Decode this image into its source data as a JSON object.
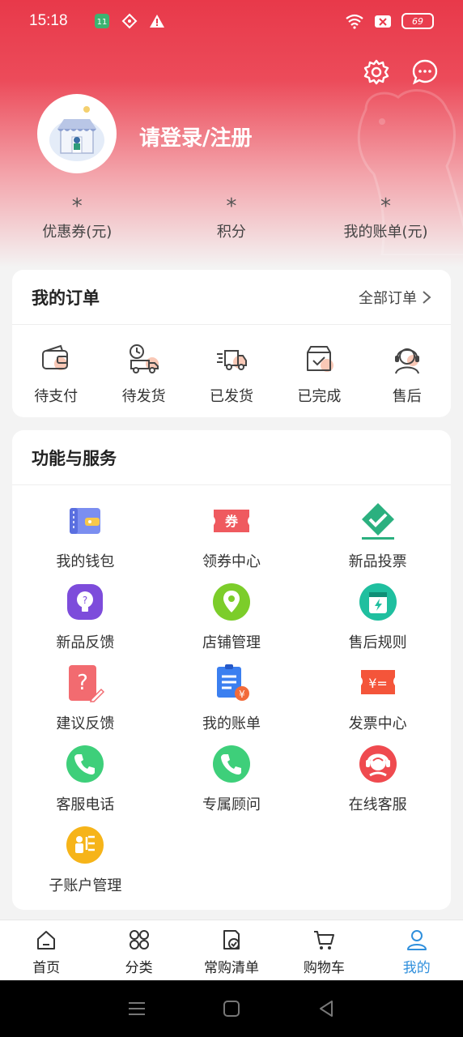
{
  "status_bar": {
    "time": "15:18",
    "battery": "69"
  },
  "header": {
    "login_text": "请登录/注册",
    "stats": [
      {
        "value": "*",
        "label": "优惠券(元)"
      },
      {
        "value": "*",
        "label": "积分"
      },
      {
        "value": "*",
        "label": "我的账单(元)"
      }
    ]
  },
  "orders": {
    "title": "我的订单",
    "all_link": "全部订单",
    "items": [
      {
        "label": "待支付",
        "icon": "wallet-icon"
      },
      {
        "label": "待发货",
        "icon": "truck-clock-icon"
      },
      {
        "label": "已发货",
        "icon": "delivery-truck-icon"
      },
      {
        "label": "已完成",
        "icon": "box-check-icon"
      },
      {
        "label": "售后",
        "icon": "headset-icon"
      }
    ]
  },
  "services": {
    "title": "功能与服务",
    "items": [
      {
        "label": "我的钱包",
        "icon": "wallet-icon"
      },
      {
        "label": "领券中心",
        "icon": "coupon-icon",
        "badge": "券"
      },
      {
        "label": "新品投票",
        "icon": "vote-icon"
      },
      {
        "label": "新品反馈",
        "icon": "lightbulb-icon"
      },
      {
        "label": "店铺管理",
        "icon": "location-pin-icon"
      },
      {
        "label": "售后规则",
        "icon": "rules-icon"
      },
      {
        "label": "建议反馈",
        "icon": "question-edit-icon"
      },
      {
        "label": "我的账单",
        "icon": "bill-icon"
      },
      {
        "label": "发票中心",
        "icon": "invoice-icon",
        "badge": "¥="
      },
      {
        "label": "客服电话",
        "icon": "phone-icon"
      },
      {
        "label": "专属顾问",
        "icon": "phone-icon"
      },
      {
        "label": "在线客服",
        "icon": "online-service-icon"
      },
      {
        "label": "子账户管理",
        "icon": "sub-account-icon"
      }
    ]
  },
  "tabs": [
    {
      "label": "首页",
      "icon": "home-icon"
    },
    {
      "label": "分类",
      "icon": "category-icon"
    },
    {
      "label": "常购清单",
      "icon": "list-check-icon"
    },
    {
      "label": "购物车",
      "icon": "cart-icon"
    },
    {
      "label": "我的",
      "icon": "user-icon",
      "active": true
    }
  ],
  "colors": {
    "brand": "#e8394a",
    "tab_active": "#2f8fdc"
  }
}
